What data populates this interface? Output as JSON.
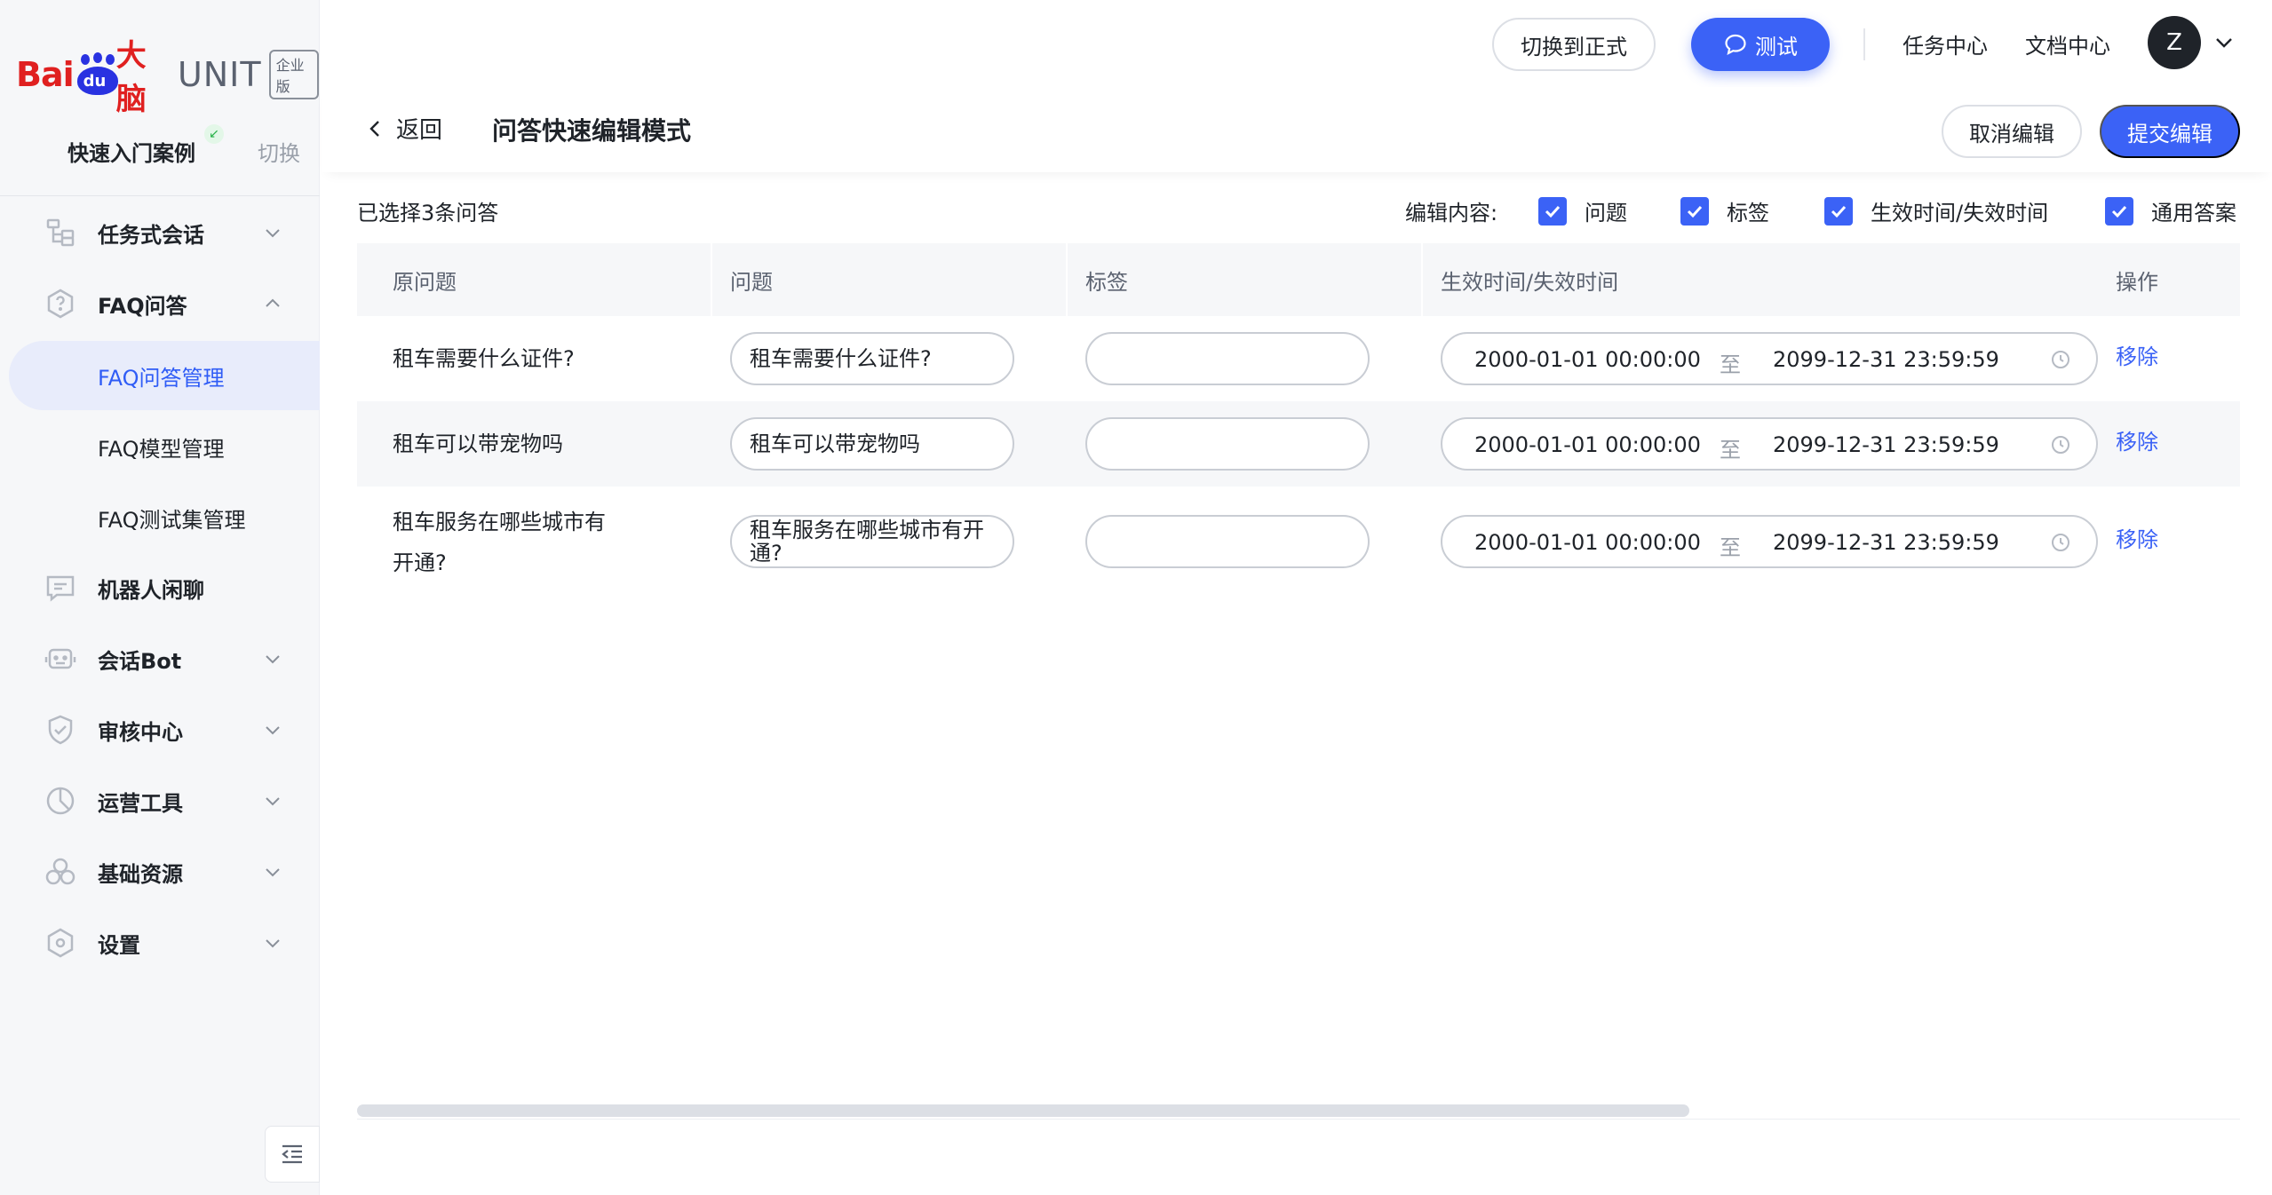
{
  "brand": {
    "bai": "Bai",
    "du": "du",
    "danao": "大脑",
    "unit": "UNIT",
    "edition": "企业版"
  },
  "project": {
    "name": "快速入门案例",
    "switch_label": "切换"
  },
  "sidebar": {
    "items": [
      {
        "label": "任务式会话",
        "icon": "task-tree-icon"
      },
      {
        "label": "FAQ问答",
        "icon": "faq-icon"
      },
      {
        "label": "FAQ问答管理"
      },
      {
        "label": "FAQ模型管理"
      },
      {
        "label": "FAQ测试集管理"
      },
      {
        "label": "机器人闲聊",
        "icon": "chat-icon"
      },
      {
        "label": "会话Bot",
        "icon": "bot-icon"
      },
      {
        "label": "审核中心",
        "icon": "shield-icon"
      },
      {
        "label": "运营工具",
        "icon": "chart-icon"
      },
      {
        "label": "基础资源",
        "icon": "resources-icon"
      },
      {
        "label": "设置",
        "icon": "settings-icon"
      }
    ]
  },
  "header": {
    "switch_button": "切换到正式",
    "test_button": "测试",
    "task_center": "任务中心",
    "doc_center": "文档中心",
    "avatar_initial": "Z"
  },
  "editbar": {
    "back": "返回",
    "title": "问答快速编辑模式",
    "cancel": "取消编辑",
    "submit": "提交编辑"
  },
  "selection": {
    "selected_text": "已选择3条问答",
    "edit_content_label": "编辑内容:",
    "options": [
      {
        "label": "问题",
        "checked": true
      },
      {
        "label": "标签",
        "checked": true
      },
      {
        "label": "生效时间/失效时间",
        "checked": true
      },
      {
        "label": "通用答案",
        "checked": true
      }
    ]
  },
  "table": {
    "columns": [
      "原问题",
      "问题",
      "标签",
      "生效时间/失效时间",
      "操作"
    ],
    "range_separator": "至",
    "remove_label": "移除",
    "rows": [
      {
        "original": "租车需要什么证件?",
        "question": "租车需要什么证件?",
        "tag": "",
        "start": "2000-01-01 00:00:00",
        "end": "2099-12-31 23:59:59"
      },
      {
        "original": "租车可以带宠物吗",
        "question": "租车可以带宠物吗",
        "tag": "",
        "start": "2000-01-01 00:00:00",
        "end": "2099-12-31 23:59:59"
      },
      {
        "original_line1": "租车服务在哪些城市有",
        "original_line2": "开通?",
        "question_line1": "租车服务在哪些城市有开",
        "question_line2": "通?",
        "tag": "",
        "start": "2000-01-01 00:00:00",
        "end": "2099-12-31 23:59:59"
      }
    ]
  },
  "colors": {
    "primary": "#3b62f6",
    "brand_red": "#e02020",
    "brand_blue": "#2932e1",
    "sidebar_bg": "#f6f7f9",
    "active_bg": "#e8ecfb"
  }
}
